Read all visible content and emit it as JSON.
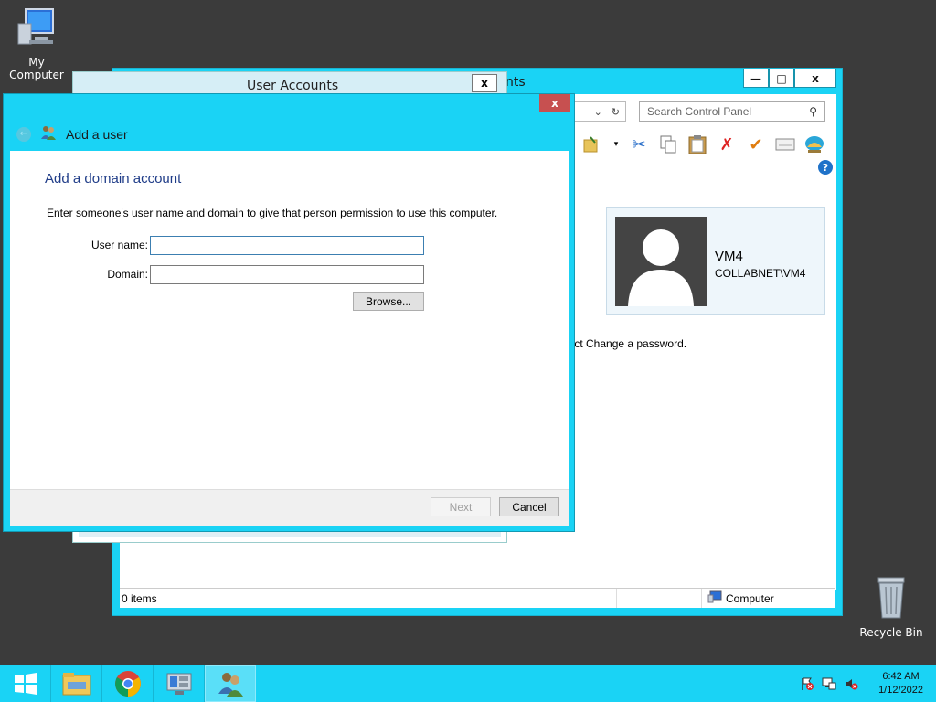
{
  "desktop": {
    "my_computer_label": "My Computer",
    "recycle_bin_label": "Recycle Bin"
  },
  "control_panel_window": {
    "title_fragment": "nts",
    "minimize_label": "—",
    "maximize_label": "□",
    "close_label": "x",
    "search_placeholder": "Search Control Panel",
    "user_card": {
      "name": "VM4",
      "domain": "COLLABNET\\VM4"
    },
    "hint_fragment": "lect Change a password.",
    "status": {
      "items": "0 items",
      "location": "Computer"
    }
  },
  "user_accounts_window": {
    "title": "User Accounts",
    "close_label": "x"
  },
  "add_user_dialog": {
    "close_label": "x",
    "header_title": "Add a user",
    "heading": "Add a domain account",
    "instruction": "Enter someone's user name and domain to give that person permission to use this computer.",
    "username_label": "User name:",
    "username_value": "",
    "domain_label": "Domain:",
    "domain_value": "",
    "browse_label": "Browse...",
    "next_label": "Next",
    "cancel_label": "Cancel"
  },
  "taskbar": {
    "items": [
      "start-button",
      "file-explorer",
      "chrome",
      "server-manager",
      "user-accounts"
    ],
    "clock_time": "6:42 AM",
    "clock_date": "1/12/2022"
  },
  "colors": {
    "accent": "#1ad3f5",
    "heading_blue": "#1f3c88",
    "close_red": "#c75050"
  }
}
